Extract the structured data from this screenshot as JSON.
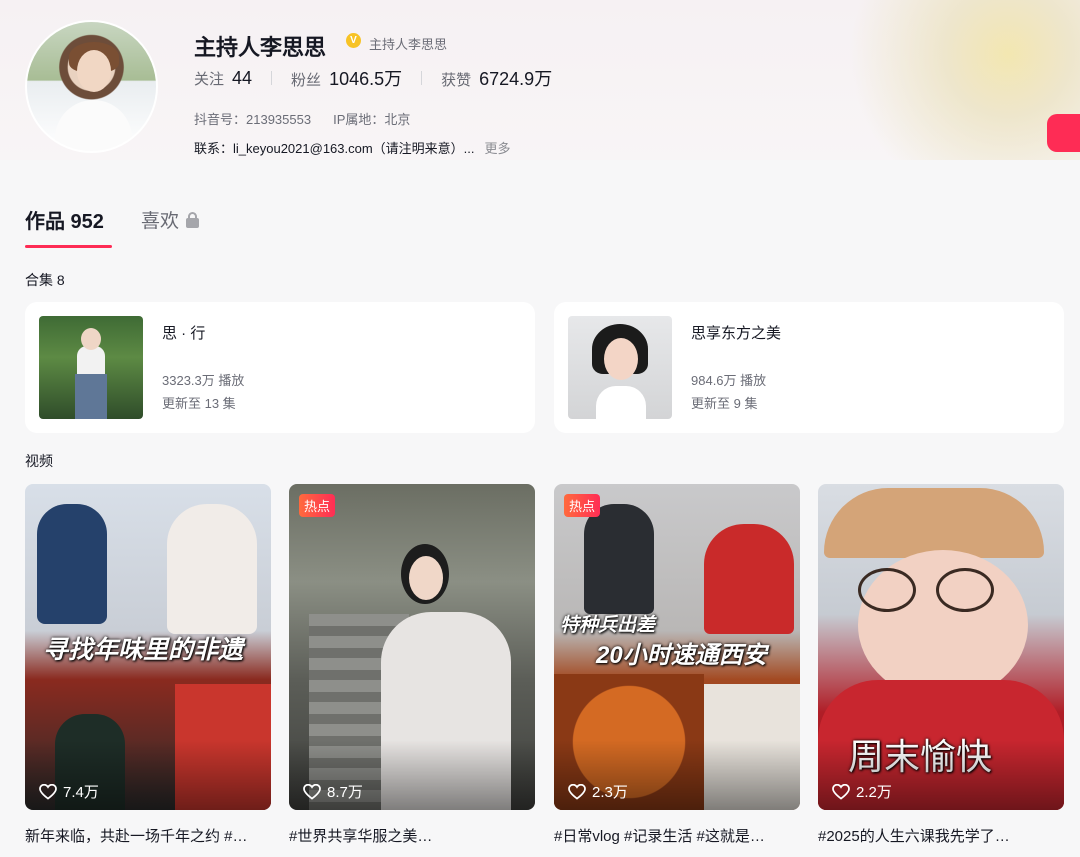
{
  "profile": {
    "name": "主持人李思思",
    "verify_text": "主持人李思思",
    "verify_glyph": "V",
    "stats": [
      {
        "label": "关注",
        "value": "44"
      },
      {
        "label": "粉丝",
        "value": "1046.5万"
      },
      {
        "label": "获赞",
        "value": "6724.9万"
      }
    ],
    "douyin_id": "抖音号：213935553",
    "ip_location": "IP属地：北京",
    "contact": "联系：li_keyou2021@163.com（请注明来意）...",
    "more_label": "更多"
  },
  "tabs": {
    "works": "作品 952",
    "likes": "喜欢"
  },
  "collections": {
    "title": "合集 8",
    "items": [
      {
        "title": "思 · 行",
        "plays": "3323.3万 播放",
        "episodes": "更新至 13 集"
      },
      {
        "title": "思享东方之美",
        "plays": "984.6万 播放",
        "episodes": "更新至 9 集"
      }
    ]
  },
  "videos": {
    "title": "视频",
    "items": [
      {
        "likes": "7.4万",
        "caption": "新年来临，共赴一场千年之约 #…",
        "overlay": "寻找年味里的非遗"
      },
      {
        "likes": "8.7万",
        "caption": "#世界共享华服之美…",
        "badge": "热点"
      },
      {
        "likes": "2.3万",
        "caption": "#日常vlog #记录生活 #这就是…",
        "badge": "热点",
        "overlay_line1": "特种兵出差",
        "overlay_line2": "20小时速通西安"
      },
      {
        "likes": "2.2万",
        "caption": "#2025的人生六课我先学了…",
        "overlay": "周末愉快"
      }
    ]
  },
  "colors": {
    "accent": "#fe2c55",
    "verify": "#f7c325"
  }
}
